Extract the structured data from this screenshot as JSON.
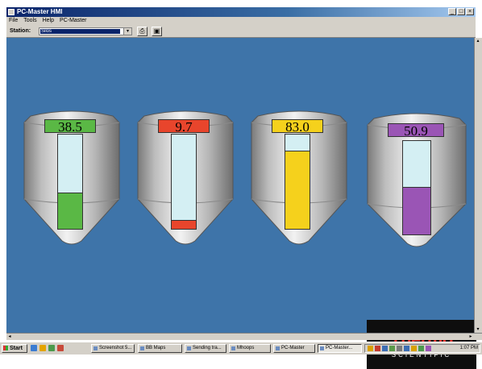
{
  "window": {
    "title": "PC-Master HMI",
    "controls": [
      "_",
      "□",
      "×"
    ]
  },
  "menu": [
    "File",
    "Tools",
    "Help",
    "PC-Master"
  ],
  "toolbar": {
    "station_label": "Station:",
    "station_value": "Silos"
  },
  "silos": [
    {
      "value": "38.5",
      "level": 0.385,
      "color": "#5ab845"
    },
    {
      "value": "9.7",
      "level": 0.097,
      "color": "#e8452c"
    },
    {
      "value": "83.0",
      "level": 0.83,
      "color": "#f5d11c"
    },
    {
      "value": "50.9",
      "level": 0.509,
      "color": "#9a55b5"
    }
  ],
  "logo": {
    "brand": "Thermo",
    "tagline": "SCIENTIFIC"
  },
  "taskbar": {
    "start_label": "Start",
    "tasks": [
      "Screenshot 5...",
      "BB Maps",
      "Sending tra...",
      "Mhoops",
      "PC-Master",
      "PC-Master..."
    ],
    "active_task": 5,
    "clock": "1:07 PM"
  }
}
